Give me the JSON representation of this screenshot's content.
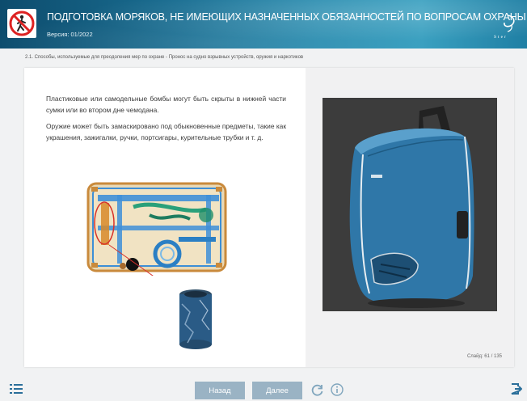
{
  "header": {
    "title": "ПОДГОТОВКА МОРЯКОВ, НЕ ИМЕЮЩИХ НАЗНАЧЕННЫХ ОБЯЗАННОСТЕЙ ПО ВОПРОСАМ ОХРАНЫ",
    "version": "Версия: 01/2022",
    "logo_icon": "no-person-sign-icon",
    "brand_icon": "brand-logo-icon"
  },
  "breadcrumb": "2.1. Способы, используемые для преодоления мер по охране - Пронос на судно взрывных устройств, оружия и наркотиков",
  "content": {
    "paragraph_1": "Пластиковые или самодельные бомбы могут быть скрыты в нижней части сумки или во втором дне чемодана.",
    "paragraph_2": "Оружие может быть замаскировано под обыкновенные предметы, такие как украшения, зажигалки, ручки, портсигары, курительные трубки и т. д."
  },
  "slide_number": "Слайд: 61 / 135",
  "footer": {
    "back_label": "Назад",
    "next_label": "Далее",
    "toc_icon": "list-icon",
    "reload_icon": "reload-icon",
    "info_icon": "info-icon",
    "exit_icon": "exit-icon"
  },
  "colors": {
    "header": "#1a6f93",
    "button": "#9ab3c4",
    "accent": "#2b6f9a"
  }
}
